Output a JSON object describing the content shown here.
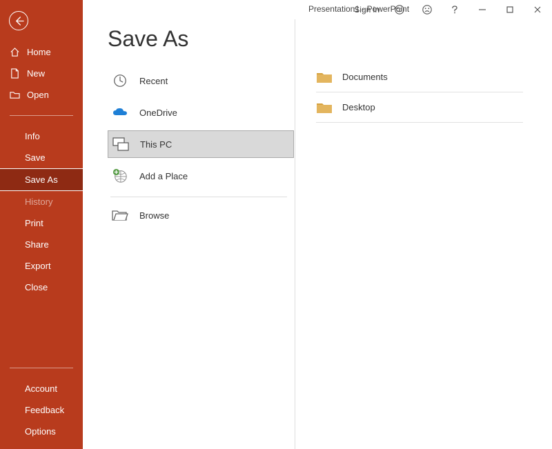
{
  "window": {
    "title": "Presentation1  -  PowerPoint",
    "signin": "Sign in"
  },
  "sidebar": {
    "home": "Home",
    "new": "New",
    "open": "Open",
    "info": "Info",
    "save": "Save",
    "save_as": "Save As",
    "history": "History",
    "print": "Print",
    "share": "Share",
    "export": "Export",
    "close": "Close",
    "account": "Account",
    "feedback": "Feedback",
    "options": "Options"
  },
  "page": {
    "title": "Save As"
  },
  "places": {
    "recent": "Recent",
    "onedrive": "OneDrive",
    "thispc": "This PC",
    "addplace": "Add a Place",
    "browse": "Browse"
  },
  "locations": {
    "documents": "Documents",
    "desktop": "Desktop"
  }
}
